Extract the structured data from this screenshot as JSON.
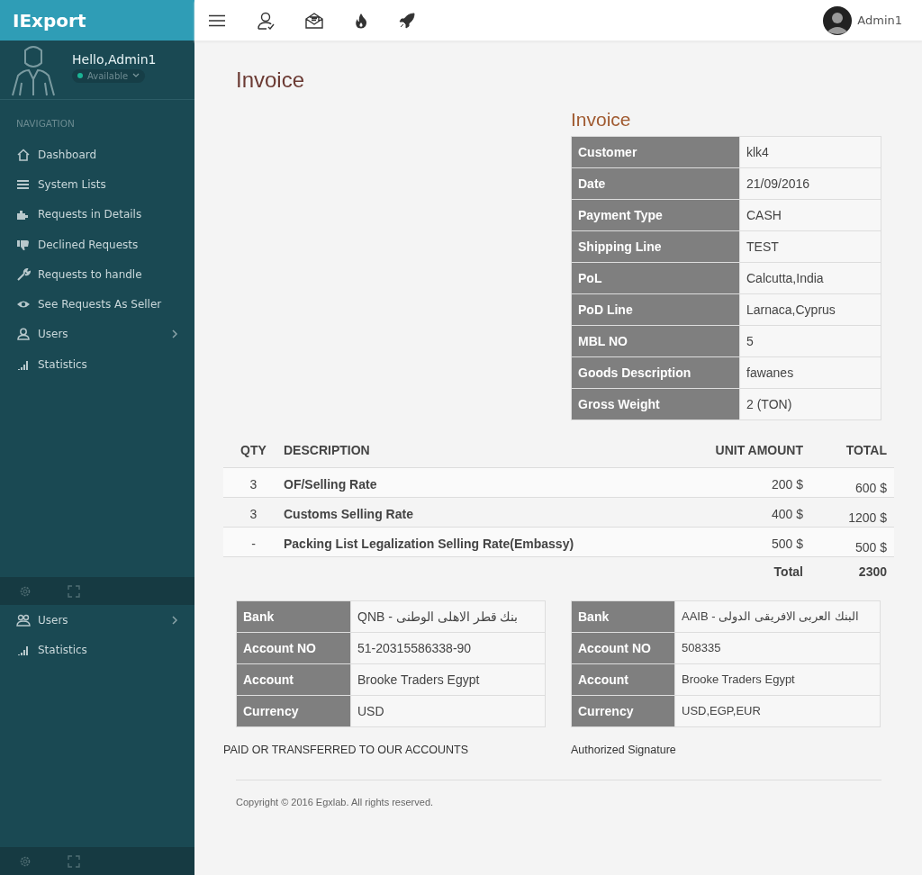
{
  "brand": "IExport",
  "profile": {
    "greeting": "Hello,Admin1",
    "status": "Available",
    "online": true
  },
  "nav_label": "NAVIGATION",
  "nav_items": [
    {
      "label": "Dashboard",
      "expandable": false
    },
    {
      "label": "System Lists",
      "expandable": false
    },
    {
      "label": "Requests in Details",
      "expandable": false
    },
    {
      "label": "Declined Requests",
      "expandable": false
    },
    {
      "label": "Requests to handle",
      "expandable": false
    },
    {
      "label": "See Requests As Seller",
      "expandable": false
    },
    {
      "label": "Users",
      "expandable": true
    },
    {
      "label": "Statistics",
      "expandable": false
    }
  ],
  "nav_overflow_items": [
    {
      "label": "Users",
      "expandable": true
    },
    {
      "label": "Statistics",
      "expandable": false
    }
  ],
  "topbar": {
    "user_name": "Admin1"
  },
  "page_title": "Invoice",
  "invoice": {
    "title": "Invoice",
    "details": [
      {
        "label": "Customer",
        "value": "klk4"
      },
      {
        "label": "Date",
        "value": "21/09/2016"
      },
      {
        "label": "Payment Type",
        "value": "CASH"
      },
      {
        "label": "Shipping Line",
        "value": "TEST"
      },
      {
        "label": "PoL",
        "value": "Calcutta,India"
      },
      {
        "label": "PoD Line",
        "value": "Larnaca,Cyprus"
      },
      {
        "label": "MBL NO",
        "value": "5"
      },
      {
        "label": "Goods Description",
        "value": "fawanes"
      },
      {
        "label": "Gross Weight",
        "value": "2 (TON)"
      }
    ]
  },
  "items": {
    "columns": [
      "QTY",
      "DESCRIPTION",
      "UNIT AMOUNT",
      "TOTAL"
    ],
    "rows": [
      {
        "qty": "3",
        "description": "OF/Selling Rate",
        "unit_amount": "200 $",
        "total": "600 $"
      },
      {
        "qty": "3",
        "description": "Customs Selling Rate",
        "unit_amount": "400 $",
        "total": "1200 $"
      },
      {
        "qty": "-",
        "description": "Packing List Legalization Selling Rate(Embassy)",
        "unit_amount": "500 $",
        "total": "500 $"
      }
    ],
    "total_label": "Total",
    "total_value": "2300"
  },
  "banks": [
    [
      {
        "label": "Bank",
        "value": "QNB - بنك قطر الاهلى الوطنى"
      },
      {
        "label": "Account NO",
        "value": "51-20315586338-90"
      },
      {
        "label": "Account",
        "value": "Brooke Traders Egypt"
      },
      {
        "label": "Currency",
        "value": "USD"
      }
    ],
    [
      {
        "label": "Bank",
        "value": "AAIB - البنك العربى الافريقى الدولى"
      },
      {
        "label": "Account NO",
        "value": "508335"
      },
      {
        "label": "Account",
        "value": "Brooke Traders Egypt"
      },
      {
        "label": "Currency",
        "value": "USD,EGP,EUR"
      }
    ]
  ],
  "payment_note": "PAID OR TRANSFERRED TO OUR ACCOUNTS",
  "signature_label": "Authorized Signature",
  "copyright": "Copyright © 2016 Egxlab. All rights reserved."
}
